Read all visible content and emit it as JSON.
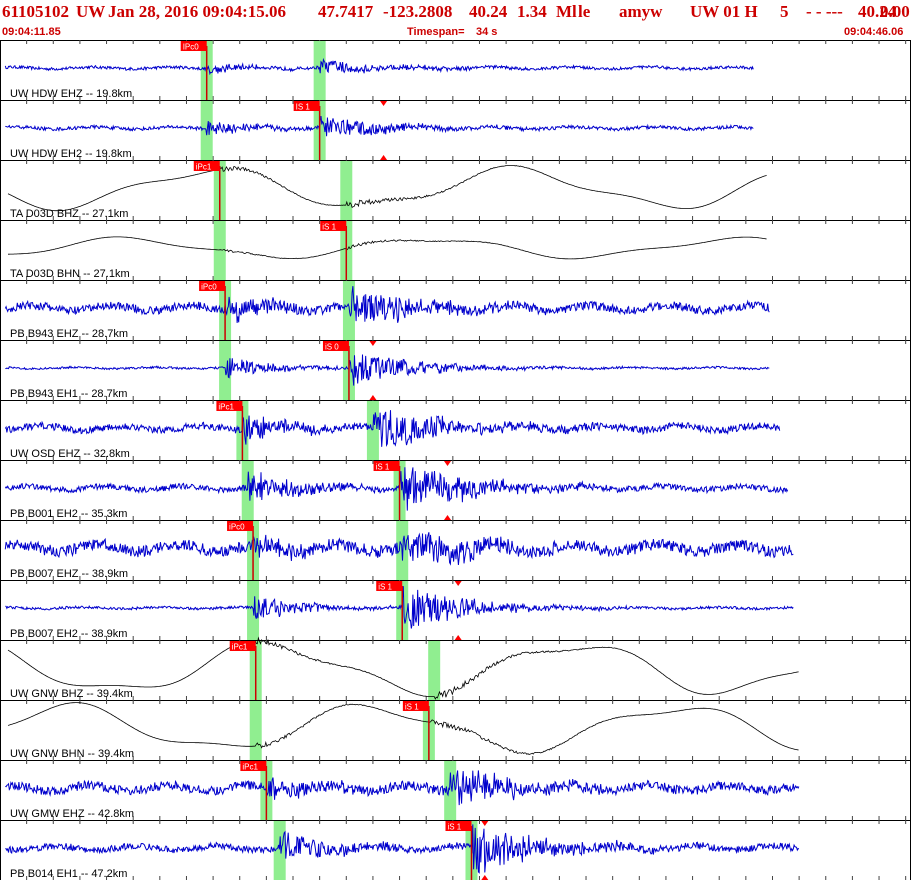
{
  "header": {
    "event_id": "61105102",
    "network": "UW",
    "datetime": "Jan 28, 2016 09:04:15.06",
    "latitude": "47.7417",
    "longitude": "-123.2808",
    "depth": "40.24",
    "magnitude": "1.34",
    "mag_type": "Ml",
    "location_flag": "le",
    "analyst": "amyw",
    "solution": "UW 01 H",
    "count": "5",
    "dashes": "- - ---",
    "depth2": "40.24",
    "rms": "0.00",
    "start_time": "09:04:11.85",
    "timespan_label": "Timespan=",
    "timespan_value": "34 s",
    "end_time": "09:04:46.06"
  },
  "colors": {
    "title": "#cc0000",
    "trace_short_period": "#0000cc",
    "trace_broadband": "#000000",
    "pick_window": "#90ee90",
    "pick_line": "#cc0000",
    "pick_flag": "#ff0000",
    "panel_border": "#000000",
    "tick": "#444444"
  },
  "icons": {
    "pick_marker": "red-triangle-marker"
  },
  "traces": [
    {
      "label": "UW HDW EHZ -- 19.8km",
      "kind": "sp",
      "amp": 0.18,
      "noise": 0.07,
      "pick": "IPc0",
      "pick_t": 7.76,
      "arr_t": 12.0,
      "s_label": "",
      "s_t": null,
      "end_t": 28.3
    },
    {
      "label": "UW HDW EH2 -- 19.8km",
      "kind": "sp",
      "amp": 0.3,
      "noise": 0.08,
      "pick": "IS 1",
      "pick_t": 12.0,
      "arr_t": 7.76,
      "s_label": "",
      "s_t": 14.4,
      "end_t": 28.3
    },
    {
      "label": "TA D03D BHZ -- 27.1km",
      "kind": "lp",
      "amp": 0.7,
      "noise": 0.015,
      "pick": "iPc1",
      "pick_t": 8.25,
      "arr_t": 13.0,
      "s_label": "",
      "s_t": null,
      "end_t": 28.8
    },
    {
      "label": "TA D03D BHN -- 27.1km",
      "kind": "lp",
      "amp": 0.35,
      "noise": 0.015,
      "pick": "iS 1",
      "pick_t": 13.0,
      "arr_t": 8.25,
      "s_label": "",
      "s_t": null,
      "end_t": 28.8
    },
    {
      "label": "PB B943 EHZ -- 28.7km",
      "kind": "sp",
      "amp": 0.5,
      "noise": 0.2,
      "pick": "iPc0",
      "pick_t": 8.45,
      "arr_t": 13.1,
      "s_label": "",
      "s_t": null,
      "end_t": 28.9
    },
    {
      "label": "PB B943 EH1 -- 28.7km",
      "kind": "sp",
      "amp": 0.45,
      "noise": 0.05,
      "pick": "iS 0",
      "pick_t": 13.1,
      "arr_t": 8.45,
      "s_label": "",
      "s_t": 14.0,
      "end_t": 28.9
    },
    {
      "label": "UW OSD EHZ -- 32.8km",
      "kind": "sp",
      "amp": 0.55,
      "noise": 0.17,
      "pick": "iPc1",
      "pick_t": 9.1,
      "arr_t": 14.0,
      "s_label": "",
      "s_t": null,
      "end_t": 29.3
    },
    {
      "label": "PB B001 EH2 -- 35.3km",
      "kind": "sp",
      "amp": 0.65,
      "noise": 0.14,
      "pick": "iS 1",
      "pick_t": 15.0,
      "arr_t": 9.3,
      "s_label": "",
      "s_t": 16.8,
      "end_t": 29.6
    },
    {
      "label": "PB B007 EHZ -- 38.9km",
      "kind": "sp",
      "amp": 0.45,
      "noise": 0.28,
      "pick": "iPc0",
      "pick_t": 9.5,
      "arr_t": 15.1,
      "s_label": "",
      "s_t": null,
      "end_t": 29.8
    },
    {
      "label": "PB B007 EH2 -- 38.9km",
      "kind": "sp",
      "amp": 0.55,
      "noise": 0.06,
      "pick": "iS 1",
      "pick_t": 15.1,
      "arr_t": 9.5,
      "s_label": "",
      "s_t": 17.2,
      "end_t": 29.8
    },
    {
      "label": "UW GNW BHZ -- 39.4km",
      "kind": "lp",
      "amp": 0.9,
      "noise": 0.01,
      "pick": "iPc1",
      "pick_t": 9.6,
      "arr_t": 16.3,
      "s_label": "",
      "s_t": null,
      "end_t": 30.0
    },
    {
      "label": "UW GNW BHN -- 39.4km",
      "kind": "lp",
      "amp": 0.8,
      "noise": 0.01,
      "pick": "iS 1",
      "pick_t": 16.1,
      "arr_t": 9.6,
      "s_label": "",
      "s_t": null,
      "end_t": 30.0
    },
    {
      "label": "UW GMW EHZ -- 42.8km",
      "kind": "sp",
      "amp": 0.45,
      "noise": 0.22,
      "pick": "iPc1",
      "pick_t": 10.0,
      "arr_t": 16.9,
      "s_label": "",
      "s_t": null,
      "end_t": 30.0
    },
    {
      "label": "PB B014 EH1 -- 47.2km",
      "kind": "sp",
      "amp": 0.65,
      "noise": 0.16,
      "pick": "iS 1",
      "pick_t": 17.7,
      "arr_t": 10.5,
      "s_label": "",
      "s_t": 18.2,
      "end_t": 30.0
    }
  ]
}
